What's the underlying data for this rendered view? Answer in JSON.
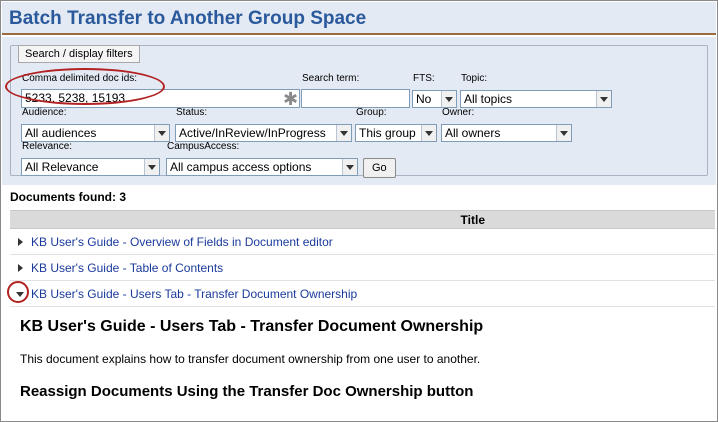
{
  "header": {
    "title": "Batch Transfer to Another Group Space"
  },
  "filters": {
    "legend": "Search / display filters",
    "doc_ids": {
      "label": "Comma delimited doc ids:",
      "value": "5233, 5238, 15193"
    },
    "search_term": {
      "label": "Search term:",
      "value": ""
    },
    "fts": {
      "label": "FTS:",
      "value": "No"
    },
    "topic": {
      "label": "Topic:",
      "value": "All topics"
    },
    "audience": {
      "label": "Audience:",
      "value": "All audiences"
    },
    "status": {
      "label": "Status:",
      "value": "Active/InReview/InProgress"
    },
    "group": {
      "label": "Group:",
      "value": "This group"
    },
    "owner": {
      "label": "Owner:",
      "value": "All owners"
    },
    "relevance": {
      "label": "Relevance:",
      "value": "All Relevance"
    },
    "campus_access": {
      "label": "CampusAccess:",
      "value": "All campus access options"
    },
    "go_label": "Go"
  },
  "results": {
    "count_text": "Documents found: 3",
    "column_title": "Title",
    "rows": [
      {
        "title": "KB User's Guide - Overview of Fields in Document editor",
        "expanded": false
      },
      {
        "title": "KB User's Guide - Table of Contents",
        "expanded": false
      },
      {
        "title": "KB User's Guide - Users Tab - Transfer Document Ownership",
        "expanded": true
      }
    ]
  },
  "document": {
    "title": "KB User's Guide - Users Tab - Transfer Document Ownership",
    "description": "This document explains how to transfer document ownership from one user to another.",
    "subheading": "Reassign Documents Using the Transfer Doc Ownership button"
  },
  "colors": {
    "title": "#2a5a9c",
    "header_rule": "#9c6b3b",
    "link": "#1a3a9c",
    "annotation": "#b22222",
    "panel_bg": "#e4eaf4"
  },
  "icons": {
    "required": "asterisk-icon",
    "collapsed": "triangle-right-icon",
    "expanded": "triangle-down-icon",
    "dropdown": "chevron-down-icon"
  }
}
